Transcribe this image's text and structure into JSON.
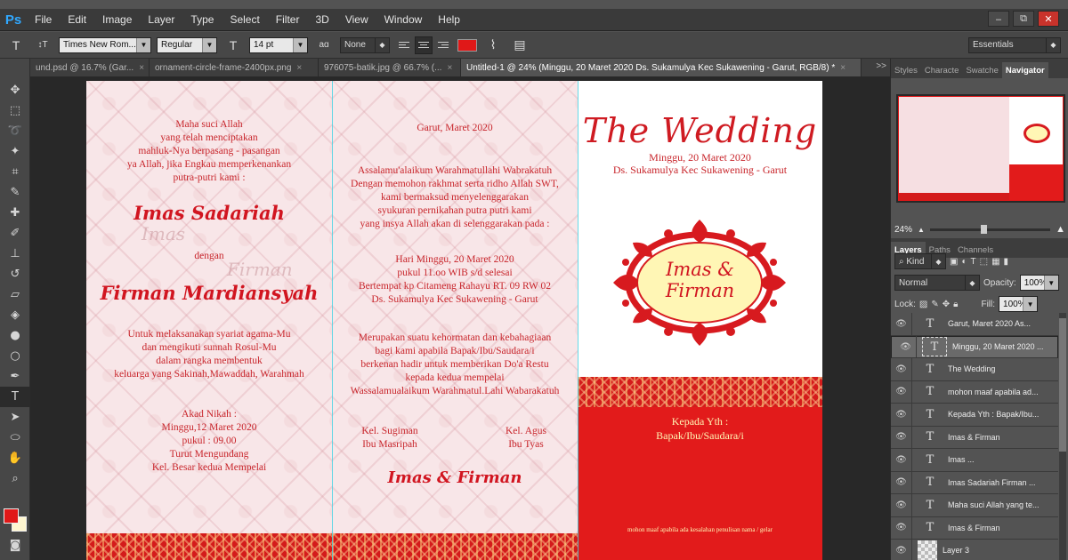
{
  "app": {
    "logo": "Ps"
  },
  "menu": [
    "File",
    "Edit",
    "Image",
    "Layer",
    "Type",
    "Select",
    "Filter",
    "3D",
    "View",
    "Window",
    "Help"
  ],
  "window_controls": {
    "minimize": "‒",
    "restore": "⧉",
    "close": "✕"
  },
  "options": {
    "tool_icon": "T",
    "orient_icon": "↕T",
    "font_family": "Times New Rom...",
    "font_style": "Regular",
    "size_icon": "T",
    "font_size": "14 pt",
    "aa_icon": "aɑ",
    "antialias": "None",
    "text_color": "#e01818",
    "workspace": "Essentials"
  },
  "tabs": [
    {
      "label": "und.psd @ 16.7% (Gar...",
      "close": "×"
    },
    {
      "label": "ornament-circle-frame-2400px.png",
      "close": "×"
    },
    {
      "label": "976075-batik.jpg @ 66.7% (...",
      "close": "×"
    },
    {
      "label": "Untitled-1 @ 24% (Minggu, 20 Maret 2020 Ds. Sukamulya Kec Sukawening - Garut, RGB/8) *",
      "close": "×"
    }
  ],
  "tabs_more": ">>",
  "document": {
    "panel1": {
      "poem": "Maha suci Allah\nyang telah menciptakan\nmahluk-Nya berpasang - pasangan\nya Allah, jika Engkau memperkenankan\nputra-putri kami :",
      "bride": "Imas Sadariah",
      "ghost_bride": "Imas",
      "with": "dengan",
      "ghost_groom": "Firman",
      "groom": "Firman Mardiansyah",
      "purpose": "Untuk melaksanakan syariat agama-Mu\ndan mengikuti sunnah Rosul-Mu\ndalam rangka membentuk\nkeluarga yang Sakinah,Mawaddah, Warahmah",
      "akad": "Akad Nikah :\nMinggu,12 Maret 2020\npukul : 09.00\nTurut Mengundang\nKel. Besar kedua Mempelai"
    },
    "panel2": {
      "place_date": "Garut,  Maret 2020",
      "greeting": "Assalamu'alaikum Warahmatullahi Wabrakatuh\nDengan memohon rakhmat serta ridho Allah SWT,\nkami bermaksud  menyelenggarakan\nsyukuran pernikahan putra putri kami\nyang insya Allah akan di selenggarakan pada :",
      "event": "Hari Minggu, 20 Maret 2020\npukul 11.oo WIB s/d selesai\nBertempat kp Citameng Rahayu RT. 09 RW 02\nDs. Sukamulya Kec Sukawening - Garut",
      "closing": "Merupakan suatu kehormatan dan kebahagiaan\nbagi kami apabila Bapak/Ibu/Saudara/i\nberkenan hadir untuk memberikan Do'a Restu\nkepada kedua mempelai\nWassalamualaikum Warahmatul.Lahi Wabarakatuh",
      "family_left": "Kel. Sugiman\nIbu Masripah",
      "family_right": "Kel. Agus\nIbu Tyas",
      "couple": "Imas & Firman"
    },
    "panel3": {
      "title": "The Wedding",
      "date": "Minggu, 20 Maret 2020",
      "location": "Ds. Sukamulya Kec Sukawening - Garut",
      "emblem_line1": "Imas &",
      "emblem_line2": "Firman",
      "to_label": "Kepada Yth :",
      "to_name": "Bapak/Ibu/Saudara/i",
      "apology": "mohon maaf apabila ada kesalahan penulisan nama / gelar"
    },
    "colors": {
      "red": "#e21b1b",
      "text_red": "#c8252b",
      "cream": "#fff6b5"
    }
  },
  "right_panel": {
    "top_tabs": [
      "Styles",
      "Characte",
      "Swatche",
      "Navigator"
    ],
    "zoom": "24%",
    "zoom_level": 0.42,
    "layer_tabs": [
      "Layers",
      "Paths",
      "Channels"
    ],
    "kind": "Kind",
    "blend_mode": "Normal",
    "opacity_label": "Opacity:",
    "opacity": "100%",
    "lock_label": "Lock:",
    "fill_label": "Fill:",
    "fill": "100%",
    "layers": [
      {
        "name": "Garut,  Maret 2020   As...",
        "type": "T",
        "selected": false
      },
      {
        "name": "Minggu, 20 Maret 2020 ...",
        "type": "T",
        "selected": true
      },
      {
        "name": "The Wedding",
        "type": "T",
        "selected": false
      },
      {
        "name": "mohon maaf apabila ad...",
        "type": "T",
        "selected": false
      },
      {
        "name": "Kepada Yth : Bapak/Ibu...",
        "type": "T",
        "selected": false
      },
      {
        "name": "Imas & Firman",
        "type": "T",
        "selected": false
      },
      {
        "name": "Imas                  ...",
        "type": "T",
        "selected": false
      },
      {
        "name": "Imas Sadariah   Firman ...",
        "type": "T",
        "selected": false
      },
      {
        "name": "Maha suci Allah  yang te...",
        "type": "T",
        "selected": false
      },
      {
        "name": "Imas &       Firman",
        "type": "T",
        "selected": false
      },
      {
        "name": "Layer 3",
        "type": "img",
        "selected": false
      }
    ]
  }
}
